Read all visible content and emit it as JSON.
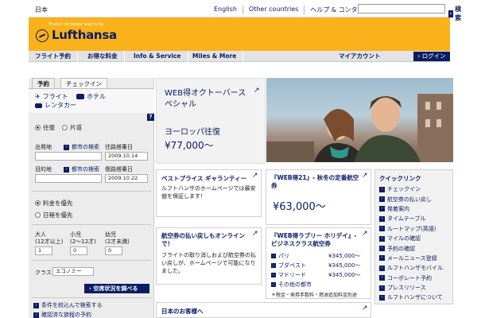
{
  "topbar": {
    "country": "日本",
    "links": [
      "English",
      "Other countries",
      "ヘルプ & コンタクト"
    ],
    "search_label": "検索"
  },
  "header": {
    "tagline": "There's no better way to fly.",
    "brand": "Lufthansa",
    "brand_color": "#0a1c63",
    "header_color": "#f9b21a"
  },
  "nav": {
    "items": [
      "フライト予約",
      "お得な料金",
      "Info & Service",
      "Miles & More"
    ],
    "account": "マイアカウント",
    "login": "ログイン"
  },
  "booking": {
    "tabs": [
      "予約",
      "チェックイン"
    ],
    "modes": [
      "フライト",
      "ホテル",
      "レンタカー"
    ],
    "trip_types": [
      "往復",
      "片道"
    ],
    "origin_label": "出発地",
    "origin_search": "都市の検索",
    "outbound_label": "往路搭乗日",
    "outbound_date": "2009.10.14",
    "dest_label": "目的地",
    "dest_search": "都市の検索",
    "return_label": "復路搭乗日",
    "return_date": "2009.10.22",
    "priority": [
      "料金を優先",
      "日程を優先"
    ],
    "pax_labels": [
      "大人",
      "小児",
      "幼児"
    ],
    "pax_ranges": [
      "(12才以上)",
      "(2〜12才)",
      "(2才未満)"
    ],
    "pax_values": [
      "1",
      "0",
      "0"
    ],
    "class_label": "クラス",
    "class_value": "エコノミー",
    "avail_button": "空席状況を調べる",
    "quick_links": [
      "条件を絞込んで検索する",
      "確認済な旅程の予約"
    ],
    "help": "?"
  },
  "hero": {
    "title": "WEB得オクトーバースペシャル",
    "subtitle": "ヨーロッパ往復",
    "price": "¥77,000〜"
  },
  "best_price": {
    "title": "ベストプライス ギャランティー",
    "text": "ルフトハンザのホームページでは最安値を保証します！"
  },
  "refund": {
    "title": "航空券の払い戻しもオンラインで！",
    "text": "フライトの取り消しおよび航空券の払い戻しが、ホームページで可能になりました。"
  },
  "japan_guests": {
    "title": "日本のお客様へ"
  },
  "web21": {
    "title": "『WEB得21』- 秋冬の定番航空券",
    "price": "¥63,000〜"
  },
  "business": {
    "title": "『WEB得ラブリー ホリデイ』- ビジネスクラス航空券",
    "destinations": [
      "パリ",
      "ブダペスト",
      "マドリード",
      "その他の都市"
    ],
    "prices": [
      "¥345,000〜",
      "¥345,000〜",
      "¥345,000〜"
    ],
    "note": "＊税金・発券手数料・燃油追加料金別途"
  },
  "quick_links": {
    "title": "クイックリンク",
    "items": [
      "チェックイン",
      "航空券の払い戻し",
      "発着案内",
      "タイムテーブル",
      "ルートマップ(英語)",
      "マイルの確認",
      "予約の確認",
      "メールニュース登録",
      "ルフトハンザモバイル",
      "コーポレート予約",
      "プレスリリース",
      "ルフトハンザについて"
    ]
  }
}
